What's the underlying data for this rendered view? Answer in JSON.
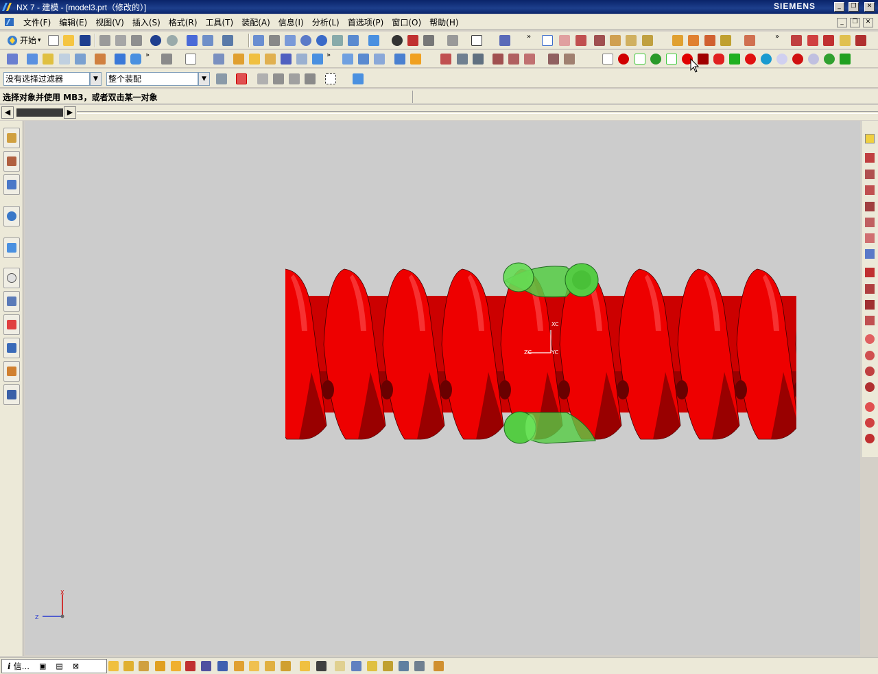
{
  "window": {
    "title": "NX 7 - 建模 - [model3.prt（修改的）]",
    "brand": "SIEMENS",
    "controls": [
      "minimize",
      "restore",
      "close"
    ]
  },
  "menubar": {
    "items": [
      "文件(F)",
      "编辑(E)",
      "视图(V)",
      "插入(S)",
      "格式(R)",
      "工具(T)",
      "装配(A)",
      "信息(I)",
      "分析(L)",
      "首选项(P)",
      "窗口(O)",
      "帮助(H)"
    ]
  },
  "toolbar": {
    "start_label": "开始"
  },
  "selection": {
    "type_filter": "没有选择过滤器",
    "scope": "整个装配"
  },
  "status": {
    "prompt": "选择对象并使用 MB3，或者双击某一对象"
  },
  "viewport": {
    "wcs_labels": {
      "x": "XC",
      "y": "YC",
      "z": "ZC"
    },
    "absolute_triad": {
      "x": "X",
      "z": "Z"
    },
    "model": {
      "part_color": "#ee0000",
      "part_dark": "#8a0000",
      "tool_color": "#55cc44",
      "background": "#cccccc"
    }
  },
  "bottombar": {
    "info_tab_label": "信..."
  }
}
